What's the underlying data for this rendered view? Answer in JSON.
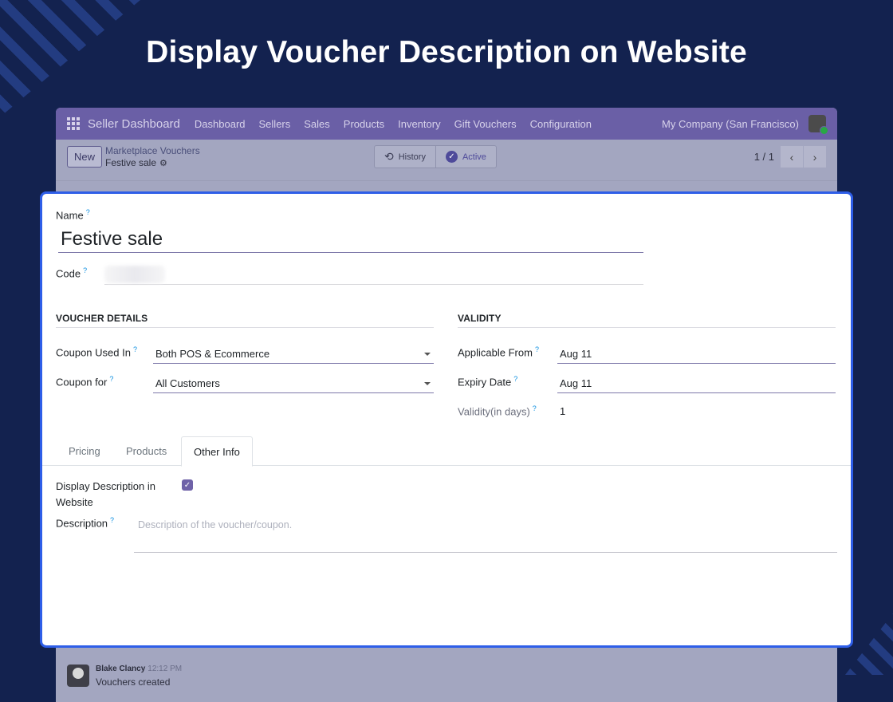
{
  "hero": {
    "title": "Display Voucher Description on Website"
  },
  "navbar": {
    "brand": "Seller Dashboard",
    "items": [
      "Dashboard",
      "Sellers",
      "Sales",
      "Products",
      "Inventory",
      "Gift Vouchers",
      "Configuration"
    ],
    "company": "My Company (San Francisco)"
  },
  "control": {
    "new_label": "New",
    "breadcrumb": "Marketplace Vouchers",
    "record_name": "Festive sale",
    "history_label": "History",
    "active_label": "Active",
    "pager": "1 / 1"
  },
  "form": {
    "name_label": "Name",
    "name_value": "Festive sale",
    "code_label": "Code",
    "help_mark": "?",
    "voucher_details_title": "VOUCHER DETAILS",
    "validity_title": "VALIDITY",
    "coupon_used_in_label": "Coupon Used In",
    "coupon_used_in_value": "Both POS & Ecommerce",
    "coupon_for_label": "Coupon for",
    "coupon_for_value": "All Customers",
    "applicable_from_label": "Applicable From",
    "applicable_from_value": "Aug 11",
    "expiry_date_label": "Expiry Date",
    "expiry_date_value": "Aug 11",
    "validity_days_label": "Validity(in days)",
    "validity_days_value": "1"
  },
  "tabs": [
    "Pricing",
    "Products",
    "Other Info"
  ],
  "other_info": {
    "display_desc_label_line1": "Display Description in",
    "display_desc_label_line2": "Website",
    "display_desc_checked": true,
    "description_label": "Description",
    "description_placeholder": "Description of the voucher/coupon."
  },
  "chatter": {
    "author": "Blake Clancy",
    "time": "12:12 PM",
    "message": "Vouchers created"
  },
  "colors": {
    "background": "#13224f",
    "navbar": "#6a5fa6",
    "highlight_border": "#2e5ee8",
    "accent": "#6f62a8",
    "help": "#0d8fe0"
  }
}
